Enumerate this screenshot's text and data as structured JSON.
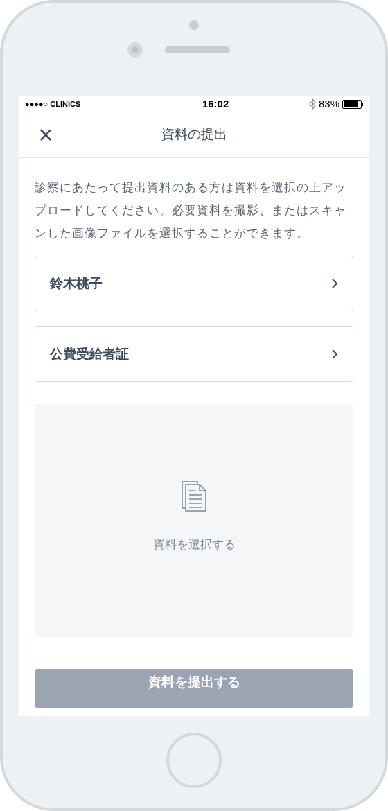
{
  "status_bar": {
    "carrier": "●●●●○ CLINICS",
    "time": "16:02",
    "battery": "83%"
  },
  "nav": {
    "title": "資料の提出",
    "close": "×"
  },
  "description": "診察にあたって提出資料のある方は資料を選択の上アップロードしてください。必要資料を撮影、またはスキャンした画像ファイルを選択することができます。",
  "documents": [
    {
      "label": "鈴木桃子"
    },
    {
      "label": "公費受給者証"
    }
  ],
  "upload": {
    "label": "資料を選択する"
  },
  "submit": {
    "label": "資料を提出する",
    "disabled": true
  }
}
